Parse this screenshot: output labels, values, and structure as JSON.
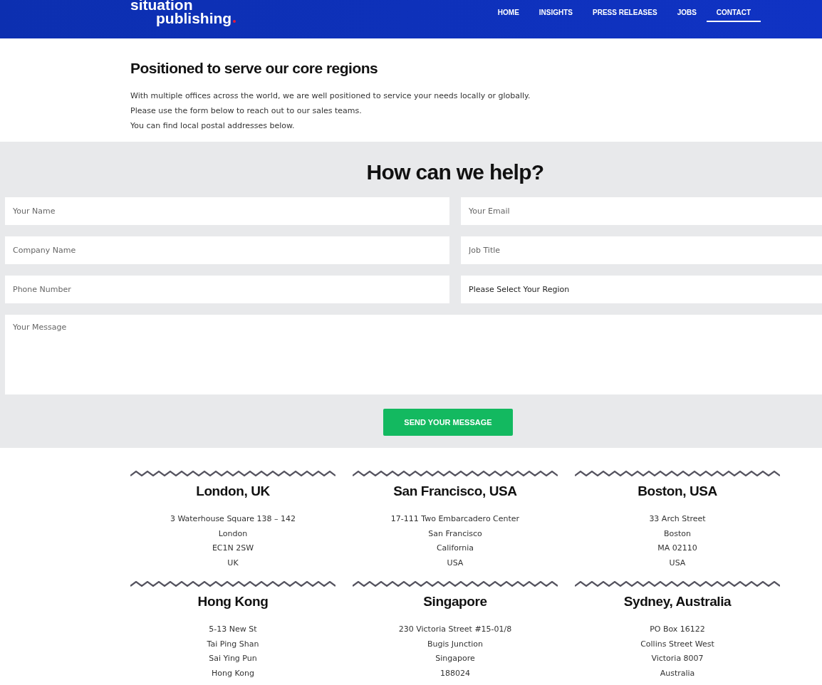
{
  "header": {
    "logo": [
      "situation",
      "publishing"
    ],
    "nav": [
      {
        "label": "HOME",
        "selected": false
      },
      {
        "label": "INSIGHTS",
        "selected": false
      },
      {
        "label": "PRESS RELEASES",
        "selected": false
      },
      {
        "label": "JOBS",
        "selected": false
      },
      {
        "label": "CONTACT",
        "selected": true
      }
    ]
  },
  "intro": {
    "title": "Positioned to serve our core regions",
    "lines": [
      "With multiple offices across the world, we are well positioned to service your needs locally or globally.",
      "Please use the form below to reach out to our sales teams.",
      "You can find local postal addresses below."
    ]
  },
  "form": {
    "title": "How can we help?",
    "fields": [
      {
        "kind": "input",
        "placeholder": "Your Name"
      },
      {
        "kind": "input",
        "placeholder": "Your Email"
      },
      {
        "kind": "input",
        "placeholder": "Company Name"
      },
      {
        "kind": "input",
        "placeholder": "Job Title"
      },
      {
        "kind": "input",
        "placeholder": "Phone Number"
      },
      {
        "kind": "select",
        "value": "Please Select Your Region"
      },
      {
        "kind": "textarea",
        "placeholder": "Your Message"
      }
    ],
    "submit": "SEND YOUR MESSAGE"
  },
  "offices": [
    {
      "city": "London, UK",
      "lines": [
        "3 Waterhouse Square 138 – 142",
        "London",
        "EC1N 2SW",
        "UK"
      ]
    },
    {
      "city": "San Francisco, USA",
      "lines": [
        "17-111 Two Embarcadero Center",
        "San Francisco",
        "California",
        "USA"
      ]
    },
    {
      "city": "Boston, USA",
      "lines": [
        "33 Arch Street",
        "Boston",
        "MA 02110",
        "USA"
      ]
    },
    {
      "city": "Hong Kong",
      "lines": [
        "5-13 New St",
        "Tai Ping Shan",
        "Sai Ying Pun",
        "Hong Kong"
      ]
    },
    {
      "city": "Singapore",
      "lines": [
        "230 Victoria Street #15-01/8",
        "Bugis Junction",
        "Singapore",
        "188024"
      ]
    },
    {
      "city": "Sydney, Australia",
      "lines": [
        "PO Box 16122",
        "Collins Street West",
        "Victoria 8007",
        "Australia"
      ]
    }
  ]
}
